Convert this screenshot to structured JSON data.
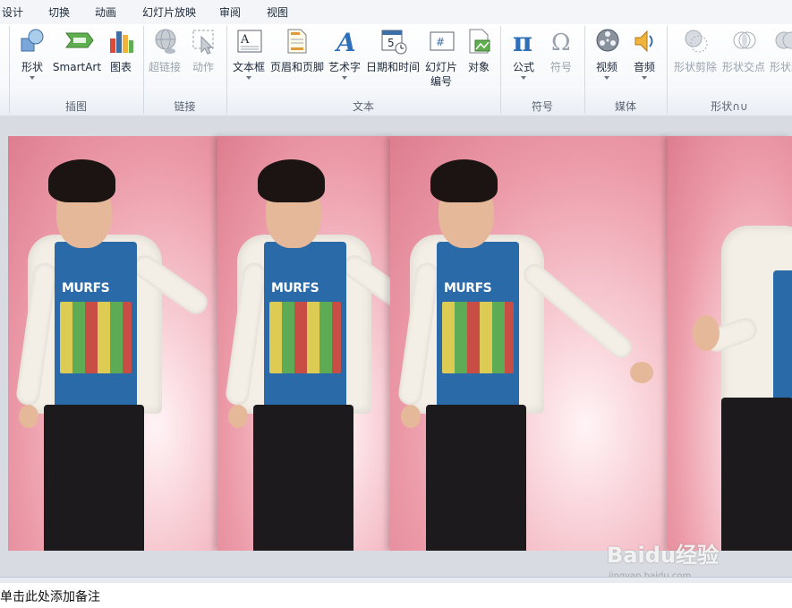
{
  "menu": {
    "tabs": [
      "设计",
      "切换",
      "动画",
      "幻灯片放映",
      "审阅",
      "视图"
    ]
  },
  "ribbon": {
    "groups": {
      "illustrations": "插图",
      "links": "链接",
      "text": "文本",
      "symbols": "符号",
      "media": "媒体",
      "shapes": "形状∩∪"
    },
    "buttons": {
      "shape": "形状",
      "smartart": "SmartArt",
      "chart": "图表",
      "hyperlink": "超链接",
      "action": "动作",
      "textbox": "文本框",
      "header_footer": "页眉和页脚",
      "wordart": "艺术字",
      "datetime": "日期和时间",
      "slide_number_1": "幻灯片",
      "slide_number_2": "编号",
      "object": "对象",
      "equation": "公式",
      "symbol": "符号",
      "video": "视频",
      "audio": "音频",
      "shape_subtract": "形状剪除",
      "shape_intersect": "形状交点",
      "shape_union": "形状组"
    }
  },
  "slide": {
    "shirt_text": "MURFS"
  },
  "notes": {
    "placeholder": "单击此处添加备注"
  },
  "watermark": {
    "logo": "Baidu经验",
    "url": "jingyan.baidu.com"
  },
  "colors": {
    "pink": "#ec9aa8",
    "accent_blue": "#2a6aa8"
  }
}
